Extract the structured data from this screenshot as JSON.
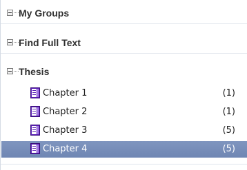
{
  "groups": [
    {
      "label": "My Groups"
    },
    {
      "label": "Find Full Text"
    },
    {
      "label": "Thesis",
      "items": [
        {
          "label": "Chapter 1",
          "count": "(1)"
        },
        {
          "label": "Chapter 2",
          "count": "(1)"
        },
        {
          "label": "Chapter 3",
          "count": "(5)"
        },
        {
          "label": "Chapter 4",
          "count": "(5)",
          "selected": true
        }
      ]
    }
  ],
  "icons": {
    "expand_collapse": "minus-icon",
    "document": "document-icon"
  },
  "colors": {
    "selected_row": "#7389B6",
    "document_icon": "#6A2CC0"
  }
}
